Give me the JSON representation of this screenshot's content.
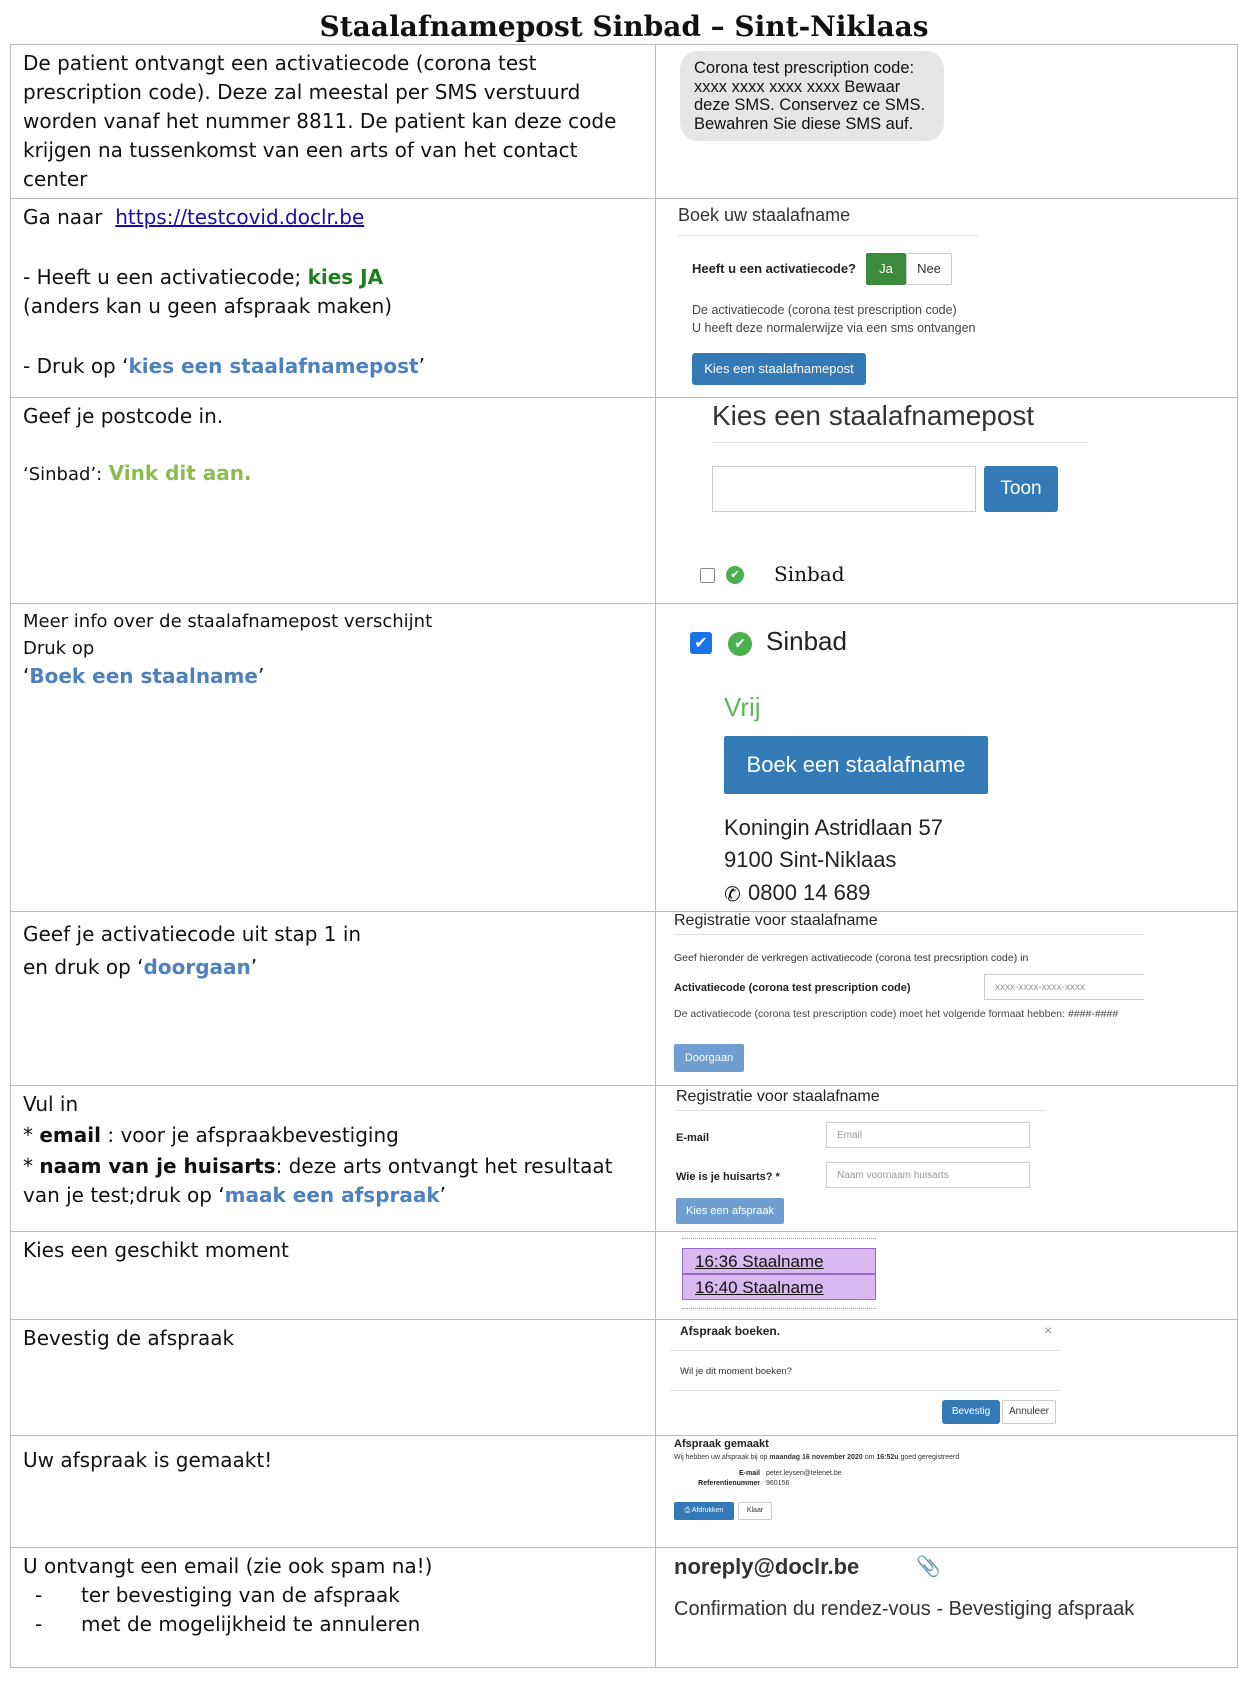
{
  "title": "Staalafnamepost Sinbad – Sint-Niklaas",
  "row1": {
    "p1": "De patient ontvangt een",
    "p2": "activatiecode (corona test prescription code). Deze zal meestal per SMS verstuurd worden vanaf het nummer 8811. De patient kan deze code krijgen na tussenkomst van een arts of van het contact center",
    "sms": "Corona test prescription code: xxxx xxxx xxxx xxxx Bewaar deze SMS. Conservez ce SMS. Bewahren Sie diese SMS auf."
  },
  "row2": {
    "go_to": "Ga naar",
    "url": "https://testcovid.doclr.be",
    "q_prefix": "- Heeft u een activatiecode;",
    "q_choice": "kies JA",
    "q_note": "(anders kan u geen afspraak maken)",
    "press_prefix": "- Druk op  ‘",
    "press_link": "kies een staalafnamepost",
    "press_suffix": "’",
    "ui": {
      "heading": "Boek uw staalafname",
      "question": "Heeft u een activatiecode?",
      "yes": "Ja",
      "no": "Nee",
      "info1": "De activatiecode (corona test prescription code)",
      "info2": "U heeft deze normalerwijze via een sms ontvangen",
      "button": "Kies een staalafnamepost"
    }
  },
  "row3": {
    "text": "Geef je postcode in.",
    "sinbad_prefix": "‘Sinbad’:",
    "sinbad_action": "Vink dit aan.",
    "ui": {
      "heading": "Kies een staalafnamepost",
      "button": "Toon",
      "site": "Sinbad"
    }
  },
  "row4": {
    "line1": "Meer info over de staalafnamepost verschijnt",
    "line2": "Druk op",
    "q_open": "‘",
    "link": "Boek een staalname",
    "q_close": "’",
    "ui": {
      "site": "Sinbad",
      "status": "Vrij",
      "button": "Boek een staalafname",
      "address1": "Koningin Astridlaan 57",
      "address2": "9100 Sint-Niklaas",
      "phone": "0800 14 689"
    }
  },
  "row5": {
    "line1": "Geef je activatiecode uit stap 1 in",
    "line2_prefix": "en druk op ‘",
    "link": "doorgaan",
    "line2_suffix": "’",
    "ui": {
      "heading": "Registratie voor staalafname",
      "instruction": "Geef hieronder de verkregen activatiecode (corona test precsription code) in",
      "label": "Activatiecode (corona test prescription code)",
      "placeholder": "xxxx-xxxx-xxxx-xxxx",
      "format": "De activatiecode (corona test prescription code) moet het volgende formaat hebben: ####-####",
      "button": "Doorgaan"
    }
  },
  "row6": {
    "line1": "Vul in",
    "email_star": "* ",
    "email_label": "email",
    "email_desc": " : voor je afspraakbevestiging",
    "doc_star": "* ",
    "doc_label": "naam van je huisarts",
    "doc_desc": ": deze arts ontvangt het resultaat van je test;druk op ‘",
    "link": "maak een afspraak",
    "suffix": "’",
    "ui": {
      "heading": "Registratie voor staalafname",
      "email_label": "E-mail",
      "email_placeholder": "Email",
      "doctor_label": "Wie is je huisarts? *",
      "doctor_placeholder": "Naam voornaam huisarts",
      "button": "Kies een afspraak"
    }
  },
  "row7": {
    "text": "Kies een geschikt moment",
    "slots": [
      "16:36 Staalname",
      "16:40 Staalname"
    ]
  },
  "row8": {
    "text": "Bevestig de afspraak",
    "ui": {
      "heading": "Afspraak boeken.",
      "close": "×",
      "question": "Wil je dit moment boeken?",
      "confirm": "Bevestig",
      "cancel": "Annuleer"
    }
  },
  "row9": {
    "text": "Uw afspraak is gemaakt!",
    "ui": {
      "heading": "Afspraak gemaakt",
      "sentence_a": "Wij hebben uw afspraak bij op",
      "date": "maandag 16 november 2020",
      "sentence_b": "om",
      "time": "16:52u",
      "sentence_c": "goed geregistreerd",
      "email_label": "E-mail",
      "email_value": "peter.leysen@telenet.be",
      "ref_label": "Referentienummer",
      "ref_value": "960156",
      "print": "Afdrukken",
      "done": "Klaar"
    }
  },
  "row10": {
    "text": "U ontvangt een email (zie ook spam na!)",
    "bullets": [
      "ter bevestiging van de afspraak",
      "met de mogelijkheid te annuleren"
    ],
    "ui": {
      "sender": "noreply@doclr.be",
      "subject": "Confirmation du rendez-vous - Bevestiging afspraak"
    }
  }
}
